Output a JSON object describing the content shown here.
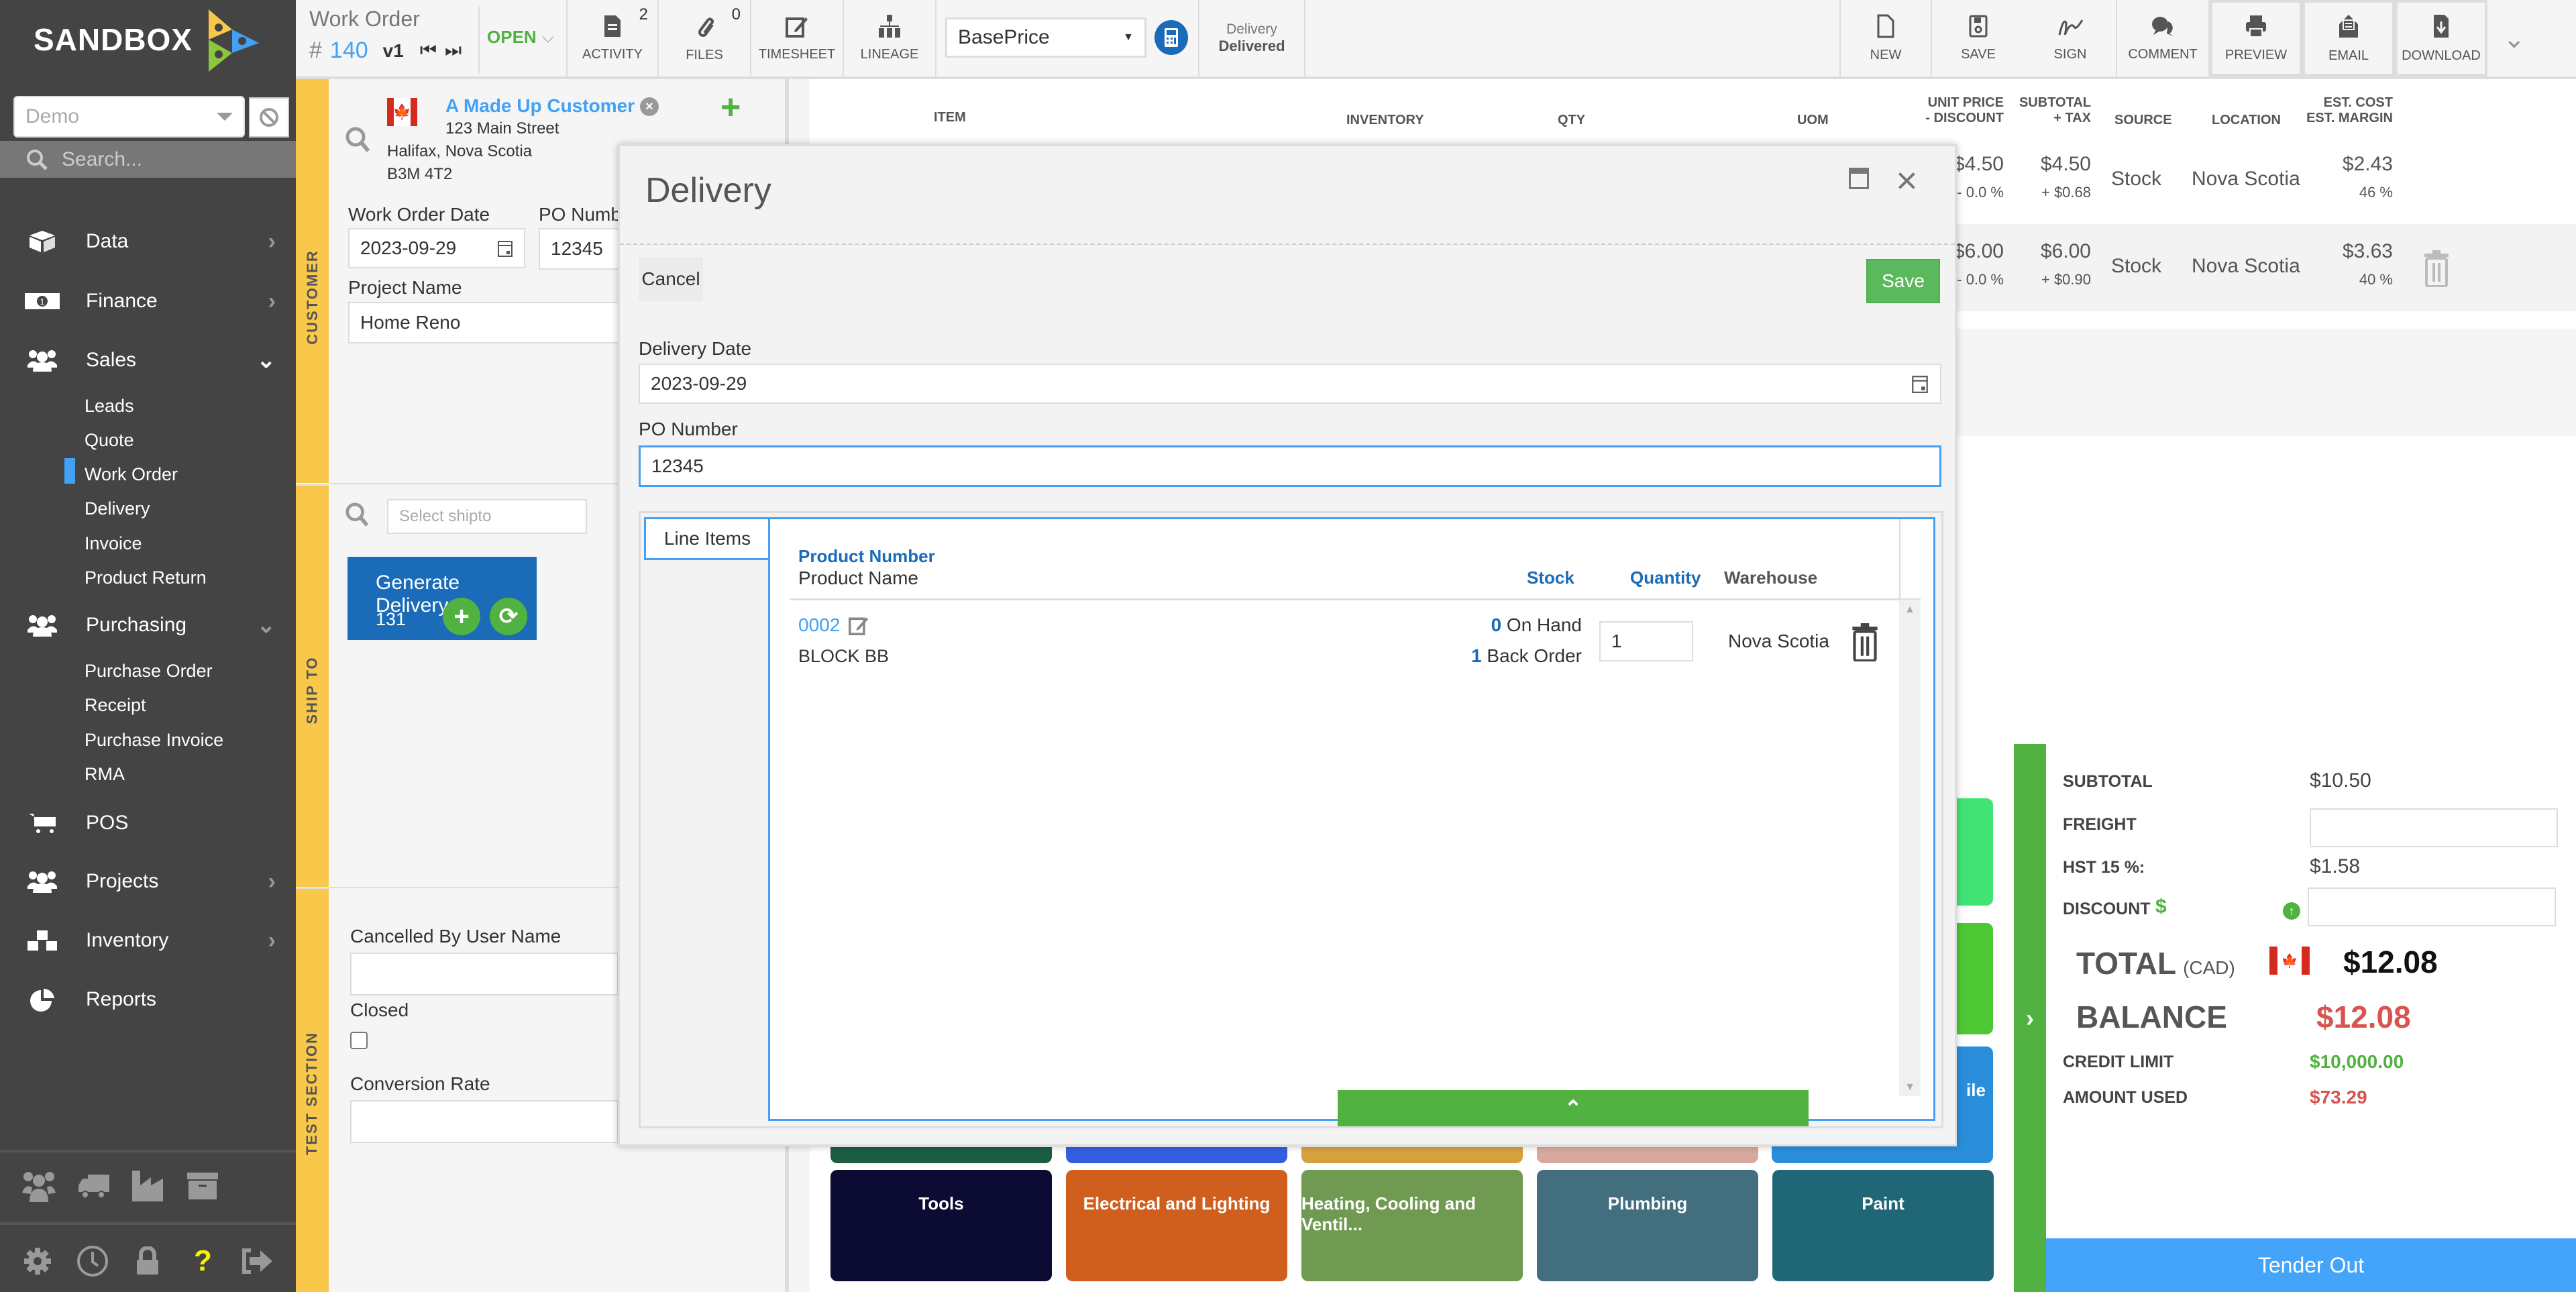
{
  "app": {
    "logo_text": "SANDBOX"
  },
  "sidebar": {
    "company": "Demo",
    "search_placeholder": "Search...",
    "items": [
      {
        "label": "Data",
        "icon": "cube-icon",
        "chevron": "›"
      },
      {
        "label": "Finance",
        "icon": "money-icon",
        "chevron": "›"
      },
      {
        "label": "Sales",
        "icon": "users-icon",
        "chevron": "⌄"
      },
      {
        "label": "Purchasing",
        "icon": "users-icon",
        "chevron": "⌄"
      },
      {
        "label": "POS",
        "icon": "cart-icon"
      },
      {
        "label": "Projects",
        "icon": "users-icon",
        "chevron": "›"
      },
      {
        "label": "Inventory",
        "icon": "cubes-icon",
        "chevron": "›"
      },
      {
        "label": "Reports",
        "icon": "pie-chart-icon"
      }
    ],
    "sales_sub": [
      "Leads",
      "Quote",
      "Work Order",
      "Delivery",
      "Invoice",
      "Product Return"
    ],
    "purchasing_sub": [
      "Purchase Order",
      "Receipt",
      "Purchase Invoice",
      "RMA"
    ],
    "active_sub": "Work Order"
  },
  "sections": {
    "customer": "CUSTOMER",
    "ship_to": "SHIP TO",
    "test": "TEST SECTION"
  },
  "header": {
    "doc_type": "Work Order",
    "hash": "#",
    "doc_number": "140",
    "version": "v1",
    "status": "OPEN",
    "activity": {
      "label": "ACTIVITY",
      "count": "2"
    },
    "files": {
      "label": "FILES",
      "count": "0"
    },
    "timesheet": "TIMESHEET",
    "lineage": "LINEAGE",
    "price_list": "BasePrice",
    "delivery_label": "Delivery",
    "delivery_status": "Delivered",
    "new": "NEW",
    "save": "SAVE",
    "sign": "SIGN",
    "comment": "COMMENT",
    "preview": "PREVIEW",
    "email": "EMAIL",
    "download": "DOWNLOAD"
  },
  "customer": {
    "name": "A Made Up Customer",
    "address1": "123 Main Street",
    "address2": "Halifax, Nova Scotia",
    "postal": "B3M 4T2",
    "wo_date_label": "Work Order Date",
    "wo_date": "2023-09-29",
    "po_label": "PO Numb",
    "po_value": "12345",
    "project_label": "Project Name",
    "project_value": "Home Reno"
  },
  "shipto": {
    "placeholder": "Select shipto",
    "generate_label": "Generate Delivery",
    "generate_count": "131"
  },
  "test_section": {
    "cancelled_label": "Cancelled By User Name",
    "closed_label": "Closed",
    "closed_checked": false,
    "conversion_label": "Conversion Rate"
  },
  "table": {
    "headers": {
      "item": "ITEM",
      "inventory": "INVENTORY",
      "qty": "QTY",
      "uom": "UOM",
      "unit_price": "UNIT PRICE",
      "discount": "- DISCOUNT",
      "subtotal": "SUBTOTAL",
      "tax": "+ TAX",
      "source": "SOURCE",
      "location": "LOCATION",
      "est_cost": "EST. COST",
      "est_margin": "EST. MARGIN"
    },
    "rows": [
      {
        "unit_price": "$4.50",
        "discount": "- 0.0 %",
        "subtotal": "$4.50",
        "tax": "+ $0.68",
        "source": "Stock",
        "location": "Nova Scotia",
        "est_cost": "$2.43",
        "margin": "46 %"
      },
      {
        "unit_price": "$6.00",
        "discount": "- 0.0 %",
        "subtotal": "$6.00",
        "tax": "+ $0.90",
        "source": "Stock",
        "location": "Nova Scotia",
        "est_cost": "$3.63",
        "margin": "40 %"
      }
    ]
  },
  "modal": {
    "title": "Delivery",
    "cancel": "Cancel",
    "save": "Save",
    "delivery_date_label": "Delivery Date",
    "delivery_date": "2023-09-29",
    "po_label": "PO Number",
    "po_value": "12345",
    "tab": "Line Items",
    "cols": {
      "product_number": "Product Number",
      "product_name": "Product Name",
      "stock": "Stock",
      "quantity": "Quantity",
      "warehouse": "Warehouse"
    },
    "line": {
      "number": "0002",
      "name": "BLOCK BB",
      "on_hand_n": "0",
      "on_hand": "On Hand",
      "back_order_n": "1",
      "back_order": "Back Order",
      "qty": "1",
      "warehouse": "Nova Scotia"
    }
  },
  "summary": {
    "subtotal_label": "SUBTOTAL",
    "subtotal": "$10.50",
    "freight_label": "FREIGHT",
    "freight": "",
    "hst_label": "HST 15 %:",
    "hst": "$1.58",
    "discount_label": "DISCOUNT",
    "discount_symbol": "$",
    "discount": "",
    "total_label": "TOTAL",
    "total_currency": "(CAD)",
    "total": "$12.08",
    "balance_label": "BALANCE",
    "balance": "$12.08",
    "credit_label": "CREDIT LIMIT",
    "credit": "$10,000.00",
    "used_label": "AMOUNT USED",
    "used": "$73.29",
    "tender": "Tender Out"
  },
  "tiles": [
    {
      "label": "Tools",
      "color": "#0b0b33"
    },
    {
      "label": "Electrical and Lighting",
      "color": "#d05f1e"
    },
    {
      "label": "Heating, Cooling and Ventil...",
      "color": "#709a52"
    },
    {
      "label": "Plumbing",
      "color": "#426e7e"
    },
    {
      "label": "Paint",
      "color": "#1f6677"
    }
  ],
  "tiles_partial": [
    {
      "color": "#1c5e42"
    },
    {
      "color": "#355de0"
    },
    {
      "color": "#d4a13e"
    },
    {
      "color": "#d7a89c"
    },
    {
      "color": "#2a8edb",
      "label": "ile"
    }
  ],
  "tiles_side": [
    {
      "color": "#41e474"
    },
    {
      "color": "#4dc734"
    }
  ],
  "colors": {
    "accent_blue": "#42a1f5",
    "green": "#51b241",
    "yellow": "#f9c84a",
    "red": "#d9534f"
  }
}
